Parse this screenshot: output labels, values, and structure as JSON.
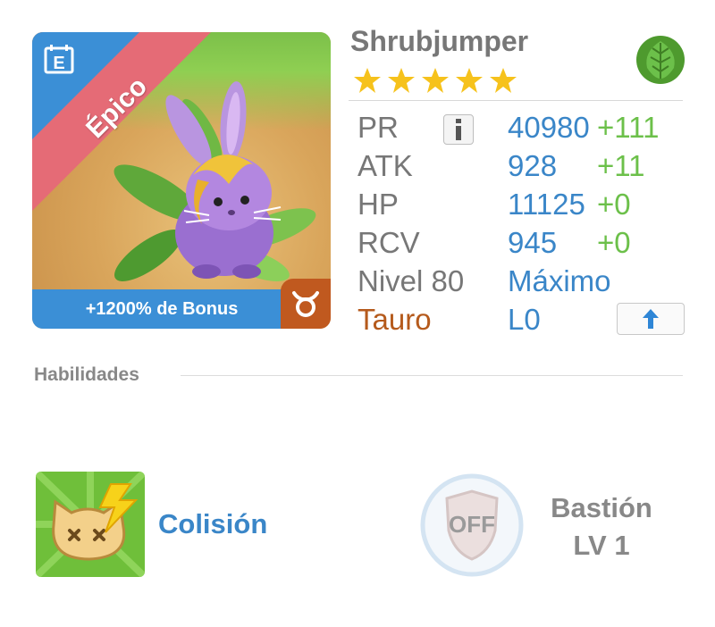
{
  "monster": {
    "name": "Shrubjumper",
    "stars": 5,
    "rarity": "Épico",
    "bonus": "+1200% de Bonus",
    "element_icon": "leaf-icon",
    "zodiac_icon": "taurus-icon"
  },
  "stats": {
    "pr": {
      "label": "PR",
      "value": "40980",
      "bonus": "+111"
    },
    "atk": {
      "label": "ATK",
      "value": "928",
      "bonus": "+11"
    },
    "hp": {
      "label": "HP",
      "value": "11125",
      "bonus": "+0"
    },
    "rcv": {
      "label": "RCV",
      "value": "945",
      "bonus": "+0"
    },
    "level": {
      "label": "Nivel 80",
      "value": "Máximo"
    },
    "zodiac": {
      "label": "Tauro",
      "value": "L0"
    }
  },
  "skills": {
    "title": "Habilidades",
    "active": {
      "name": "Colisión",
      "icon": "collision-icon"
    },
    "leader": {
      "name": "Bastión",
      "level": "LV 1",
      "status": "OFF",
      "icon": "shield-icon"
    }
  },
  "colors": {
    "accent_blue": "#3a86c8",
    "bonus_green": "#6cc04a",
    "star_yellow": "#f6c21c",
    "rarity_red": "#e56b76",
    "zodiac_brown": "#b55a1c"
  }
}
